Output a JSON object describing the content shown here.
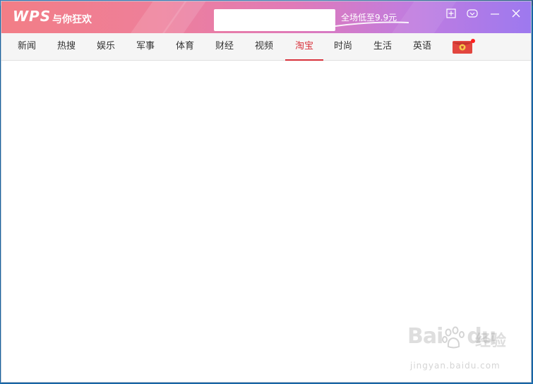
{
  "banner": {
    "logo": "WPS",
    "slogan": "与你狂欢",
    "promo_text": "全场低至9.9元",
    "colors": {
      "start": "#f27e86",
      "end": "#9d79ef"
    }
  },
  "window_controls": {
    "items": [
      {
        "name": "pin-window-icon"
      },
      {
        "name": "skin-icon"
      },
      {
        "name": "minimize-icon"
      },
      {
        "name": "close-icon"
      }
    ]
  },
  "tabs": {
    "items": [
      {
        "label": "新闻",
        "active": false
      },
      {
        "label": "热搜",
        "active": false
      },
      {
        "label": "娱乐",
        "active": false
      },
      {
        "label": "军事",
        "active": false
      },
      {
        "label": "体育",
        "active": false
      },
      {
        "label": "财经",
        "active": false
      },
      {
        "label": "视频",
        "active": false
      },
      {
        "label": "淘宝",
        "active": true
      },
      {
        "label": "时尚",
        "active": false
      },
      {
        "label": "生活",
        "active": false
      },
      {
        "label": "英语",
        "active": false
      }
    ],
    "active_color": "#d8323c",
    "red_packet_icon": "red-packet-icon"
  },
  "watermark": {
    "brand": "Bai",
    "brand_suffix": "du",
    "jingyan": "经验",
    "url": "jingyan.baidu.com"
  }
}
